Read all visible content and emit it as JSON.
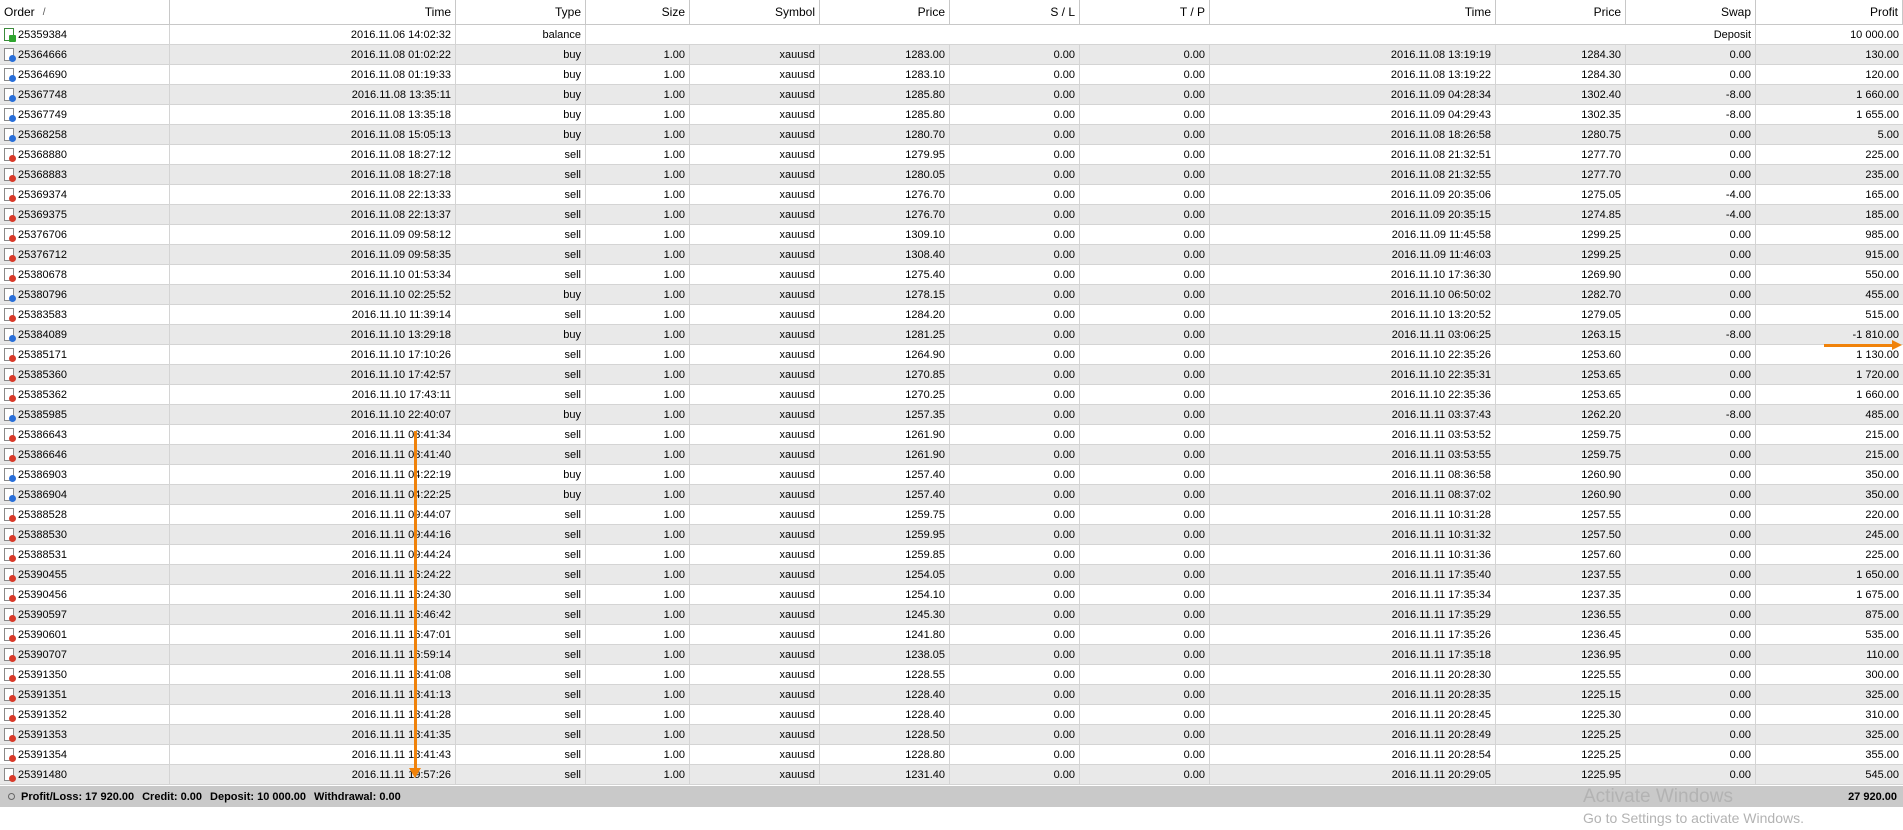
{
  "columns": [
    "Order",
    "Time",
    "Type",
    "Size",
    "Symbol",
    "Price",
    "S / L",
    "T / P",
    "Time",
    "Price",
    "Swap",
    "Profit"
  ],
  "sort_indicator": "/",
  "balance_row": {
    "order": "25359384",
    "time": "2016.11.06 14:02:32",
    "type": "balance",
    "comment": "Deposit",
    "profit": "10 000.00"
  },
  "rows": [
    [
      "25364666",
      "2016.11.08 01:02:22",
      "buy",
      "1.00",
      "xauusd",
      "1283.00",
      "0.00",
      "0.00",
      "2016.11.08 13:19:19",
      "1284.30",
      "0.00",
      "130.00"
    ],
    [
      "25364690",
      "2016.11.08 01:19:33",
      "buy",
      "1.00",
      "xauusd",
      "1283.10",
      "0.00",
      "0.00",
      "2016.11.08 13:19:22",
      "1284.30",
      "0.00",
      "120.00"
    ],
    [
      "25367748",
      "2016.11.08 13:35:11",
      "buy",
      "1.00",
      "xauusd",
      "1285.80",
      "0.00",
      "0.00",
      "2016.11.09 04:28:34",
      "1302.40",
      "-8.00",
      "1 660.00"
    ],
    [
      "25367749",
      "2016.11.08 13:35:18",
      "buy",
      "1.00",
      "xauusd",
      "1285.80",
      "0.00",
      "0.00",
      "2016.11.09 04:29:43",
      "1302.35",
      "-8.00",
      "1 655.00"
    ],
    [
      "25368258",
      "2016.11.08 15:05:13",
      "buy",
      "1.00",
      "xauusd",
      "1280.70",
      "0.00",
      "0.00",
      "2016.11.08 18:26:58",
      "1280.75",
      "0.00",
      "5.00"
    ],
    [
      "25368880",
      "2016.11.08 18:27:12",
      "sell",
      "1.00",
      "xauusd",
      "1279.95",
      "0.00",
      "0.00",
      "2016.11.08 21:32:51",
      "1277.70",
      "0.00",
      "225.00"
    ],
    [
      "25368883",
      "2016.11.08 18:27:18",
      "sell",
      "1.00",
      "xauusd",
      "1280.05",
      "0.00",
      "0.00",
      "2016.11.08 21:32:55",
      "1277.70",
      "0.00",
      "235.00"
    ],
    [
      "25369374",
      "2016.11.08 22:13:33",
      "sell",
      "1.00",
      "xauusd",
      "1276.70",
      "0.00",
      "0.00",
      "2016.11.09 20:35:06",
      "1275.05",
      "-4.00",
      "165.00"
    ],
    [
      "25369375",
      "2016.11.08 22:13:37",
      "sell",
      "1.00",
      "xauusd",
      "1276.70",
      "0.00",
      "0.00",
      "2016.11.09 20:35:15",
      "1274.85",
      "-4.00",
      "185.00"
    ],
    [
      "25376706",
      "2016.11.09 09:58:12",
      "sell",
      "1.00",
      "xauusd",
      "1309.10",
      "0.00",
      "0.00",
      "2016.11.09 11:45:58",
      "1299.25",
      "0.00",
      "985.00"
    ],
    [
      "25376712",
      "2016.11.09 09:58:35",
      "sell",
      "1.00",
      "xauusd",
      "1308.40",
      "0.00",
      "0.00",
      "2016.11.09 11:46:03",
      "1299.25",
      "0.00",
      "915.00"
    ],
    [
      "25380678",
      "2016.11.10 01:53:34",
      "sell",
      "1.00",
      "xauusd",
      "1275.40",
      "0.00",
      "0.00",
      "2016.11.10 17:36:30",
      "1269.90",
      "0.00",
      "550.00"
    ],
    [
      "25380796",
      "2016.11.10 02:25:52",
      "buy",
      "1.00",
      "xauusd",
      "1278.15",
      "0.00",
      "0.00",
      "2016.11.10 06:50:02",
      "1282.70",
      "0.00",
      "455.00"
    ],
    [
      "25383583",
      "2016.11.10 11:39:14",
      "sell",
      "1.00",
      "xauusd",
      "1284.20",
      "0.00",
      "0.00",
      "2016.11.10 13:20:52",
      "1279.05",
      "0.00",
      "515.00"
    ],
    [
      "25384089",
      "2016.11.10 13:29:18",
      "buy",
      "1.00",
      "xauusd",
      "1281.25",
      "0.00",
      "0.00",
      "2016.11.11 03:06:25",
      "1263.15",
      "-8.00",
      "-1 810.00"
    ],
    [
      "25385171",
      "2016.11.10 17:10:26",
      "sell",
      "1.00",
      "xauusd",
      "1264.90",
      "0.00",
      "0.00",
      "2016.11.10 22:35:26",
      "1253.60",
      "0.00",
      "1 130.00"
    ],
    [
      "25385360",
      "2016.11.10 17:42:57",
      "sell",
      "1.00",
      "xauusd",
      "1270.85",
      "0.00",
      "0.00",
      "2016.11.10 22:35:31",
      "1253.65",
      "0.00",
      "1 720.00"
    ],
    [
      "25385362",
      "2016.11.10 17:43:11",
      "sell",
      "1.00",
      "xauusd",
      "1270.25",
      "0.00",
      "0.00",
      "2016.11.10 22:35:36",
      "1253.65",
      "0.00",
      "1 660.00"
    ],
    [
      "25385985",
      "2016.11.10 22:40:07",
      "buy",
      "1.00",
      "xauusd",
      "1257.35",
      "0.00",
      "0.00",
      "2016.11.11 03:37:43",
      "1262.20",
      "-8.00",
      "485.00"
    ],
    [
      "25386643",
      "2016.11.11 03:41:34",
      "sell",
      "1.00",
      "xauusd",
      "1261.90",
      "0.00",
      "0.00",
      "2016.11.11 03:53:52",
      "1259.75",
      "0.00",
      "215.00"
    ],
    [
      "25386646",
      "2016.11.11 03:41:40",
      "sell",
      "1.00",
      "xauusd",
      "1261.90",
      "0.00",
      "0.00",
      "2016.11.11 03:53:55",
      "1259.75",
      "0.00",
      "215.00"
    ],
    [
      "25386903",
      "2016.11.11 04:22:19",
      "buy",
      "1.00",
      "xauusd",
      "1257.40",
      "0.00",
      "0.00",
      "2016.11.11 08:36:58",
      "1260.90",
      "0.00",
      "350.00"
    ],
    [
      "25386904",
      "2016.11.11 04:22:25",
      "buy",
      "1.00",
      "xauusd",
      "1257.40",
      "0.00",
      "0.00",
      "2016.11.11 08:37:02",
      "1260.90",
      "0.00",
      "350.00"
    ],
    [
      "25388528",
      "2016.11.11 09:44:07",
      "sell",
      "1.00",
      "xauusd",
      "1259.75",
      "0.00",
      "0.00",
      "2016.11.11 10:31:28",
      "1257.55",
      "0.00",
      "220.00"
    ],
    [
      "25388530",
      "2016.11.11 09:44:16",
      "sell",
      "1.00",
      "xauusd",
      "1259.95",
      "0.00",
      "0.00",
      "2016.11.11 10:31:32",
      "1257.50",
      "0.00",
      "245.00"
    ],
    [
      "25388531",
      "2016.11.11 09:44:24",
      "sell",
      "1.00",
      "xauusd",
      "1259.85",
      "0.00",
      "0.00",
      "2016.11.11 10:31:36",
      "1257.60",
      "0.00",
      "225.00"
    ],
    [
      "25390455",
      "2016.11.11 16:24:22",
      "sell",
      "1.00",
      "xauusd",
      "1254.05",
      "0.00",
      "0.00",
      "2016.11.11 17:35:40",
      "1237.55",
      "0.00",
      "1 650.00"
    ],
    [
      "25390456",
      "2016.11.11 16:24:30",
      "sell",
      "1.00",
      "xauusd",
      "1254.10",
      "0.00",
      "0.00",
      "2016.11.11 17:35:34",
      "1237.35",
      "0.00",
      "1 675.00"
    ],
    [
      "25390597",
      "2016.11.11 16:46:42",
      "sell",
      "1.00",
      "xauusd",
      "1245.30",
      "0.00",
      "0.00",
      "2016.11.11 17:35:29",
      "1236.55",
      "0.00",
      "875.00"
    ],
    [
      "25390601",
      "2016.11.11 16:47:01",
      "sell",
      "1.00",
      "xauusd",
      "1241.80",
      "0.00",
      "0.00",
      "2016.11.11 17:35:26",
      "1236.45",
      "0.00",
      "535.00"
    ],
    [
      "25390707",
      "2016.11.11 16:59:14",
      "sell",
      "1.00",
      "xauusd",
      "1238.05",
      "0.00",
      "0.00",
      "2016.11.11 17:35:18",
      "1236.95",
      "0.00",
      "110.00"
    ],
    [
      "25391350",
      "2016.11.11 18:41:08",
      "sell",
      "1.00",
      "xauusd",
      "1228.55",
      "0.00",
      "0.00",
      "2016.11.11 20:28:30",
      "1225.55",
      "0.00",
      "300.00"
    ],
    [
      "25391351",
      "2016.11.11 18:41:13",
      "sell",
      "1.00",
      "xauusd",
      "1228.40",
      "0.00",
      "0.00",
      "2016.11.11 20:28:35",
      "1225.15",
      "0.00",
      "325.00"
    ],
    [
      "25391352",
      "2016.11.11 18:41:28",
      "sell",
      "1.00",
      "xauusd",
      "1228.40",
      "0.00",
      "0.00",
      "2016.11.11 20:28:45",
      "1225.30",
      "0.00",
      "310.00"
    ],
    [
      "25391353",
      "2016.11.11 18:41:35",
      "sell",
      "1.00",
      "xauusd",
      "1228.50",
      "0.00",
      "0.00",
      "2016.11.11 20:28:49",
      "1225.25",
      "0.00",
      "325.00"
    ],
    [
      "25391354",
      "2016.11.11 18:41:43",
      "sell",
      "1.00",
      "xauusd",
      "1228.80",
      "0.00",
      "0.00",
      "2016.11.11 20:28:54",
      "1225.25",
      "0.00",
      "355.00"
    ],
    [
      "25391480",
      "2016.11.11 19:57:26",
      "sell",
      "1.00",
      "xauusd",
      "1231.40",
      "0.00",
      "0.00",
      "2016.11.11 20:29:05",
      "1225.95",
      "0.00",
      "545.00"
    ]
  ],
  "summary": {
    "profit_loss": "Profit/Loss: 17 920.00",
    "credit": "Credit: 0.00",
    "deposit": "Deposit: 10 000.00",
    "withdrawal": "Withdrawal: 0.00",
    "total": "27 920.00"
  },
  "watermark": {
    "title": "Activate Windows",
    "subtitle": "Go to Settings to activate Windows."
  },
  "colors": {
    "annotation_arrow": "#f0820a",
    "buy_badge": "#2a6fd8",
    "sell_badge": "#d83a2a",
    "balance_badge": "#2fa52f"
  },
  "icons": {
    "buy": "document-buy-icon",
    "sell": "document-sell-icon",
    "balance": "document-balance-icon",
    "summary": "summary-circle-icon"
  }
}
